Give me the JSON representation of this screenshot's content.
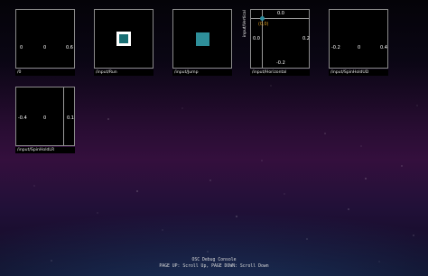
{
  "panels": [
    {
      "caption": "/0",
      "values": [
        "0",
        "0",
        "0.6"
      ]
    },
    {
      "caption": "/input/Run"
    },
    {
      "caption": "/input/Jump"
    },
    {
      "caption": "/input/Horizontal",
      "side_label": "input/Vertical",
      "top_value": "0.0",
      "left_value": "0.0",
      "right_value": "0.2",
      "bottom_value": "-0.2",
      "origin_label": "(0,0)"
    },
    {
      "caption": "/input/SpinHoldUD",
      "values": [
        "-0.2",
        "0",
        "0.4"
      ]
    },
    {
      "caption": "/input/SpinHoldLR",
      "values": [
        "-0.4",
        "0",
        "0.1"
      ]
    }
  ],
  "colors": {
    "run_button": "#ffffff",
    "jump_button": "#2e8f9a",
    "joystick_dot": "#2e8fa0",
    "origin_label": "#e3a220"
  },
  "footer": {
    "title": "OSC Debug Console",
    "hint": "PAGE UP: Scroll Up, PAGE DOWN: Scroll Down"
  }
}
